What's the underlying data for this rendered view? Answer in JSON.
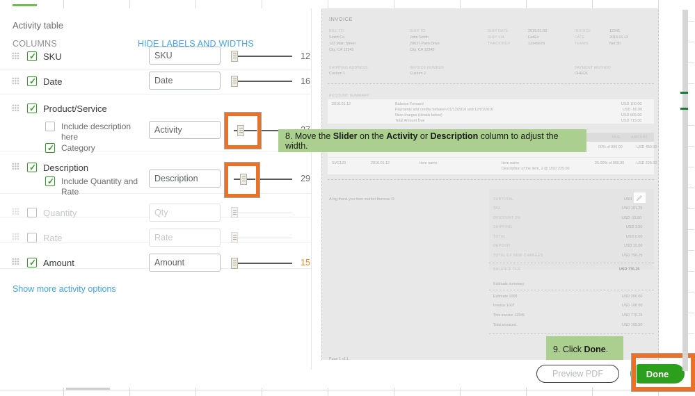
{
  "panel": {
    "title": "Activity table",
    "columns_label": "COLUMNS",
    "hide_link": "HIDE LABELS AND WIDTHS",
    "show_more": "Show more activity options",
    "rows": [
      {
        "label": "SKU",
        "checked": true,
        "enabled": true,
        "value": "SKU",
        "width": "12",
        "accent": false
      },
      {
        "label": "Date",
        "checked": true,
        "enabled": true,
        "value": "Date",
        "width": "16",
        "accent": false
      },
      {
        "label": "Product/Service",
        "checked": true,
        "enabled": true,
        "value": "Activity",
        "width": "27",
        "accent": false,
        "sub": [
          {
            "label": "Include description here",
            "checked": false
          },
          {
            "label": "Category",
            "checked": true
          }
        ]
      },
      {
        "label": "Description",
        "checked": true,
        "enabled": true,
        "value": "Description",
        "width": "29",
        "accent": false,
        "sub": [
          {
            "label": "Include Quantity and Rate",
            "checked": true
          }
        ]
      },
      {
        "label": "Quantity",
        "checked": false,
        "enabled": false,
        "value": "Qty",
        "width": "",
        "accent": false
      },
      {
        "label": "Rate",
        "checked": false,
        "enabled": false,
        "value": "Rate",
        "width": "",
        "accent": false
      },
      {
        "label": "Amount",
        "checked": true,
        "enabled": true,
        "value": "Amount",
        "width": "15",
        "accent": true
      }
    ]
  },
  "callouts": [
    {
      "id": "step8",
      "text_parts": [
        "8. Move the ",
        "Slider",
        " on the ",
        "Activity",
        " or ",
        "Description",
        " column to adjust the width."
      ]
    },
    {
      "id": "step9",
      "text_parts": [
        "9.  Click ",
        "Done",
        "."
      ]
    }
  ],
  "callout8": {
    "p1": "8. Move the ",
    "b1": "Slider",
    "p2": " on the ",
    "b2": "Activity",
    "p3": " or ",
    "b3": "Description",
    "p4": " column to adjust the width."
  },
  "callout9": {
    "p1": "9.  Click ",
    "b1": "Done",
    "p2": "."
  },
  "footer": {
    "preview_pdf": "Preview PDF",
    "done": "Done"
  },
  "preview": {
    "heading": "INVOICE",
    "bill_to_label": "BILL TO",
    "bill_to": [
      "Smith Co.",
      "123 Main Street",
      "City, CA 12345"
    ],
    "ship_to_label": "SHIP TO",
    "ship_to": [
      "John Smith",
      "20637 Palm Drive",
      "City, CA 12345"
    ],
    "ship_meta": [
      {
        "k": "SHIP DATE",
        "v": "2015.01.03"
      },
      {
        "k": "SHIP VIA",
        "v": "FedEx"
      },
      {
        "k": "TRACKING#",
        "v": "12345678"
      }
    ],
    "invoice_meta": [
      {
        "k": "INVOICE",
        "v": "12345"
      },
      {
        "k": "DATE",
        "v": "2016.01.12"
      },
      {
        "k": "TERMS",
        "v": "Net 30"
      }
    ],
    "custom_fields": [
      {
        "k": "SHIPPING ADDRESS",
        "v": "Custom 1"
      },
      {
        "k": "INVOICE NUMBER",
        "v": "Custom 2"
      },
      {
        "k": "PAYMENT METHOD",
        "v": "CHECK"
      }
    ],
    "account_summary_label": "ACCOUNT SUMMARY",
    "account_summary_date": "2016.01.12",
    "account_summary_rows": [
      {
        "k": "Balance Forward",
        "v": "USD 100.00"
      },
      {
        "k": "Payments and credits between 01/12/2016 and 12/01/2016",
        "v": "USD -50.00"
      },
      {
        "k": "New charges (details below)",
        "v": "USD 665.00"
      },
      {
        "k": "Total Amount Due",
        "v": "USD 715.00"
      }
    ],
    "table_headers": {
      "due": "DUE",
      "amount": "AMOUNT"
    },
    "table_rows": [
      {
        "sku": "",
        "date": "",
        "activity": "",
        "description": "",
        "desc2": "",
        "due": "00% of 900.00",
        "amount": "USD 450.00"
      },
      {
        "sku": "SVC123",
        "date": "2016.01.12",
        "activity": "Item name",
        "description": "Item name",
        "desc2": "Description of the item, 2 @ USD 225.00",
        "due": "25.00% of 900.00",
        "amount": "USD 225.00"
      }
    ],
    "memo": "A big thank you from mother theresa :D",
    "totals": [
      {
        "k": "SUBTOTAL",
        "v": "USD 67"
      },
      {
        "k": "TAX",
        "v": "USD 101.25"
      },
      {
        "k": "DISCOUNT 2%",
        "v": "USD -13.50"
      },
      {
        "k": "SHIPPING",
        "v": "USD 3.50"
      },
      {
        "k": "TOTAL",
        "v": "USD 0.00"
      },
      {
        "k": "DEPOSIT",
        "v": "USD 10.00"
      },
      {
        "k": "TOTAL OF NEW CHARGES",
        "v": "USD 756.25"
      }
    ],
    "balance_due": {
      "k": "BALANCE DUE",
      "v": "USD 776.25"
    },
    "estimate_summary_label": "Estimate summary",
    "estimate_rows": [
      {
        "k": "Estimate 1008",
        "v": "USD 200.00"
      },
      {
        "k": "Invoice 1007",
        "v": "USD 108.00"
      },
      {
        "k": "This invoice 12345",
        "v": "USD 776.25"
      },
      {
        "k": "Total invoiced",
        "v": "USD 165.50"
      }
    ],
    "page_label": "Page 1 of 1"
  },
  "colors": {
    "accent_orange": "#ea7125",
    "green": "#2ca01c",
    "link_blue": "#3da5f5",
    "callout_green": "#aacf8e"
  }
}
